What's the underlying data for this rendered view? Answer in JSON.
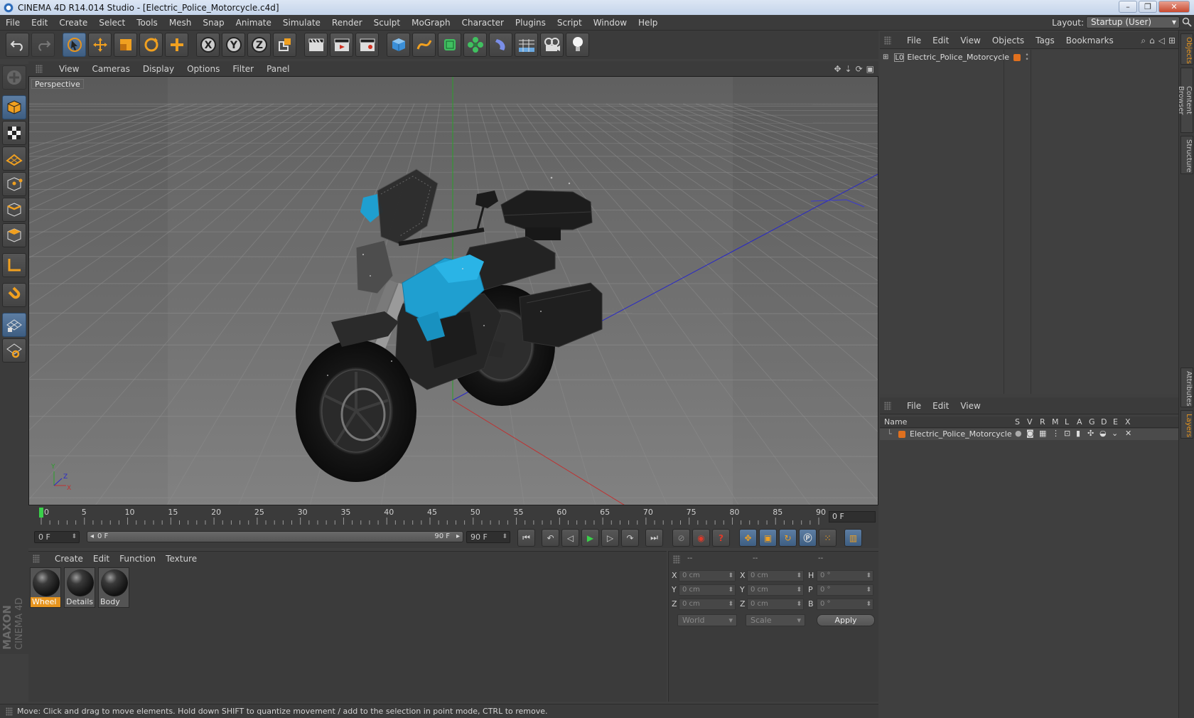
{
  "window": {
    "title": "CINEMA 4D R14.014 Studio - [Electric_Police_Motorcycle.c4d]",
    "buttons": {
      "minimize": "–",
      "restore": "❐",
      "close": "✕"
    }
  },
  "menubar": {
    "items": [
      "File",
      "Edit",
      "Create",
      "Select",
      "Tools",
      "Mesh",
      "Snap",
      "Animate",
      "Simulate",
      "Render",
      "Sculpt",
      "MoGraph",
      "Character",
      "Plugins",
      "Script",
      "Window",
      "Help"
    ],
    "layout_label": "Layout:",
    "layout_value": "Startup (User)"
  },
  "viewport": {
    "menu": [
      "View",
      "Cameras",
      "Display",
      "Options",
      "Filter",
      "Panel"
    ],
    "label": "Perspective",
    "axes": {
      "x": "X",
      "y": "Y",
      "z": "Z"
    },
    "colors": {
      "bg_top": "#5a5a5a",
      "bg_bottom": "#7c7c7c",
      "grid": "#8d8d8d",
      "axis_x": "#c03030",
      "axis_y": "#2aa02a",
      "axis_z": "#2828c8",
      "body_blue": "#1f9fd0"
    }
  },
  "timeline": {
    "ticks": [
      "0",
      "5",
      "10",
      "15",
      "20",
      "25",
      "30",
      "35",
      "40",
      "45",
      "50",
      "55",
      "60",
      "65",
      "70",
      "75",
      "80",
      "85",
      "90"
    ],
    "current_frame": "0 F"
  },
  "transport": {
    "start": "0 F",
    "slider_start": "0 F",
    "slider_end": "90 F",
    "end": "90 F"
  },
  "materials": {
    "menu": [
      "Create",
      "Edit",
      "Function",
      "Texture"
    ],
    "items": [
      {
        "name": "Wheel",
        "selected": true
      },
      {
        "name": "Details",
        "selected": false
      },
      {
        "name": "Body",
        "selected": false
      }
    ]
  },
  "coordinates": {
    "headers": [
      "--",
      "--",
      "--"
    ],
    "rows": [
      {
        "a": "X",
        "a_val": "0 cm",
        "b": "X",
        "b_val": "0 cm",
        "c": "H",
        "c_val": "0 °"
      },
      {
        "a": "Y",
        "a_val": "0 cm",
        "b": "Y",
        "b_val": "0 cm",
        "c": "P",
        "c_val": "0 °"
      },
      {
        "a": "Z",
        "a_val": "0 cm",
        "b": "Z",
        "b_val": "0 cm",
        "c": "B",
        "c_val": "0 °"
      }
    ],
    "mode": "World",
    "size_mode": "Scale",
    "apply": "Apply"
  },
  "status": "Move: Click and drag to move elements. Hold down SHIFT to quantize movement / add to the selection in point mode, CTRL to remove.",
  "objects_panel": {
    "menu": [
      "File",
      "Edit",
      "View",
      "Objects",
      "Tags",
      "Bookmarks"
    ],
    "object_name": "Electric_Police_Motorcycle"
  },
  "layers_panel": {
    "menu": [
      "File",
      "Edit",
      "View"
    ],
    "columns": [
      "Name",
      "S",
      "V",
      "R",
      "M",
      "L",
      "A",
      "G",
      "D",
      "E",
      "X"
    ],
    "row_name": "Electric_Police_Motorcycle"
  },
  "side_tabs": [
    "Objects",
    "Content Browser",
    "Structure",
    "Attributes",
    "Layers"
  ],
  "brand": {
    "line1": "MAXON",
    "line2": "CINEMA 4D"
  }
}
